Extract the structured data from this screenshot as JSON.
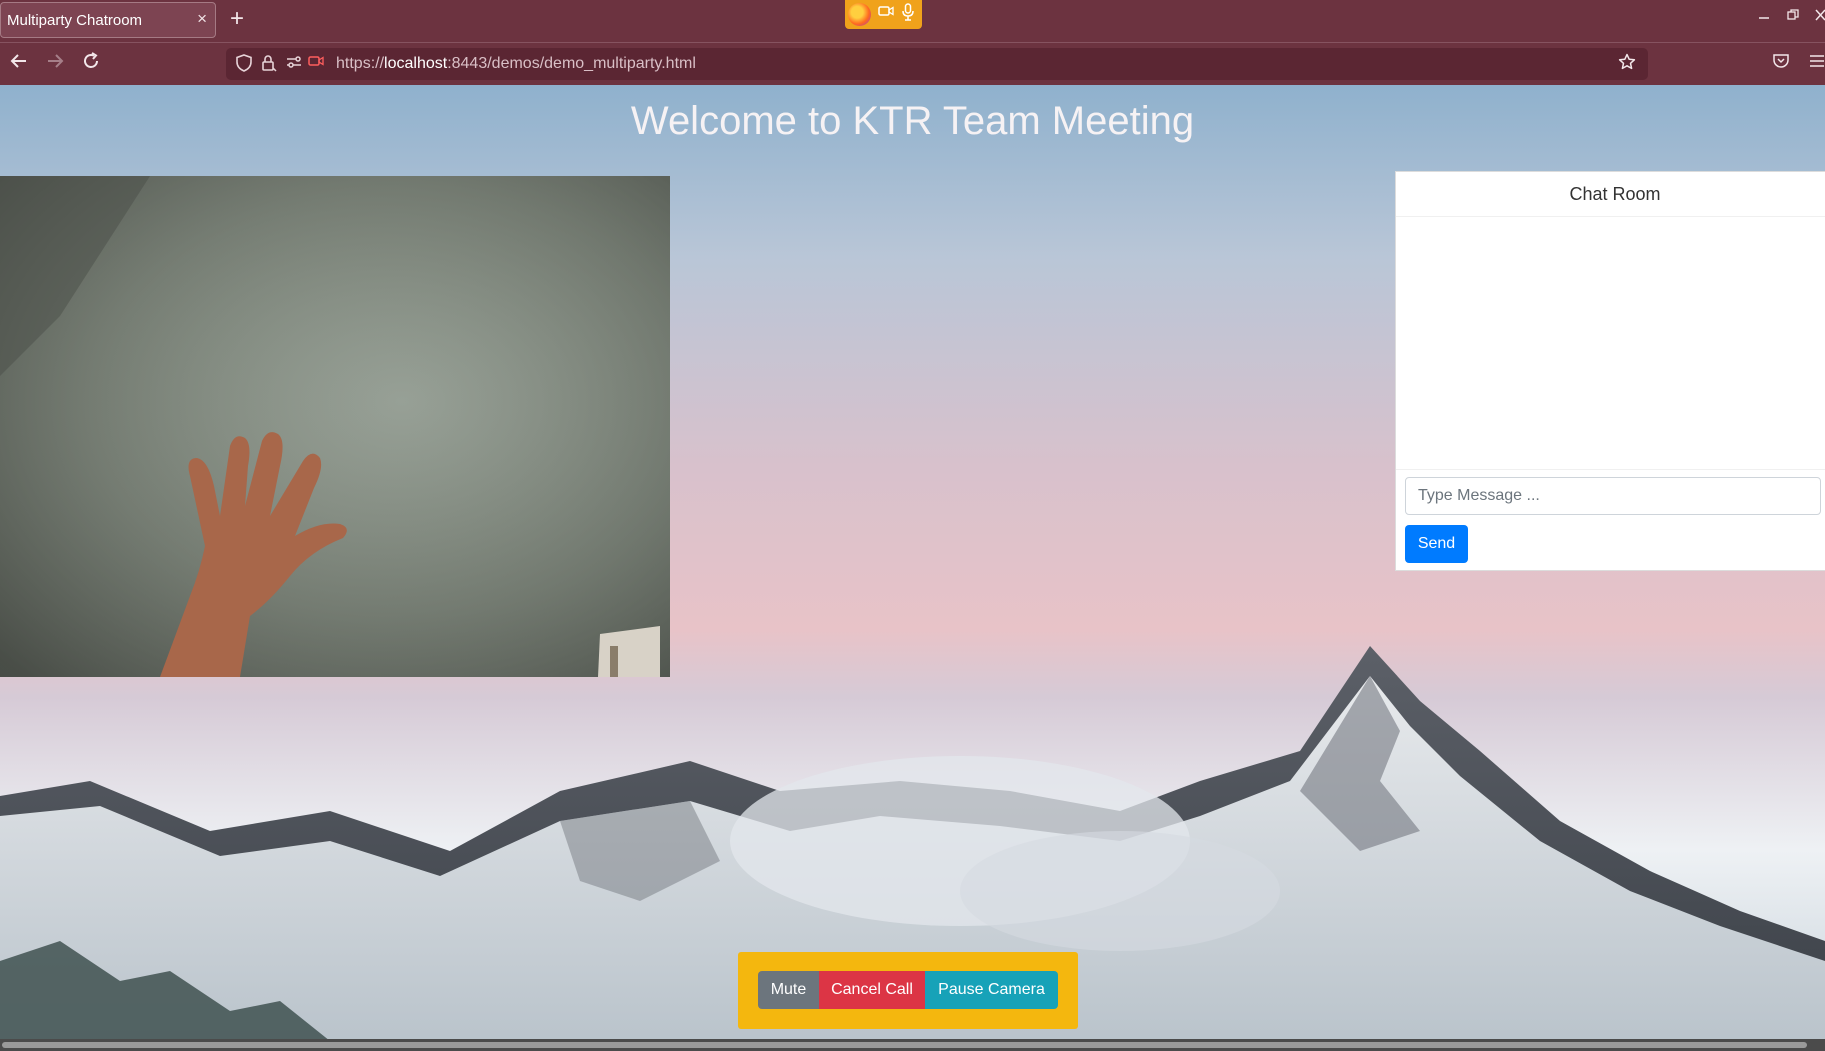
{
  "browser": {
    "tab_title": "Multiparty Chatroom",
    "tab_close": "×",
    "new_tab": "+",
    "url_prefix": "https://",
    "url_host": "localhost",
    "url_rest": ":8443/demos/demo_multiparty.html",
    "icons": {
      "back": "back-arrow-icon",
      "forward": "forward-arrow-icon",
      "reload": "reload-icon",
      "shield": "shield-icon",
      "lock": "lock-icon",
      "permissions": "permissions-icon",
      "camera_sharing": "camera-sharing-icon",
      "bookmark": "star-icon",
      "pocket": "pocket-icon",
      "menu": "hamburger-menu-icon"
    },
    "sharing_indicator_color": "#f0a21b"
  },
  "page": {
    "title": "Welcome to KTR Team Meeting"
  },
  "chat": {
    "header": "Chat Room",
    "input_placeholder": "Type Message ...",
    "send_label": "Send"
  },
  "controls": {
    "mute_label": "Mute",
    "cancel_label": "Cancel Call",
    "pause_label": "Pause Camera",
    "colors": {
      "panel": "#f4b70e",
      "mute": "#6c757d",
      "cancel": "#dc3545",
      "pause": "#17a2b8",
      "send": "#007bff"
    }
  }
}
